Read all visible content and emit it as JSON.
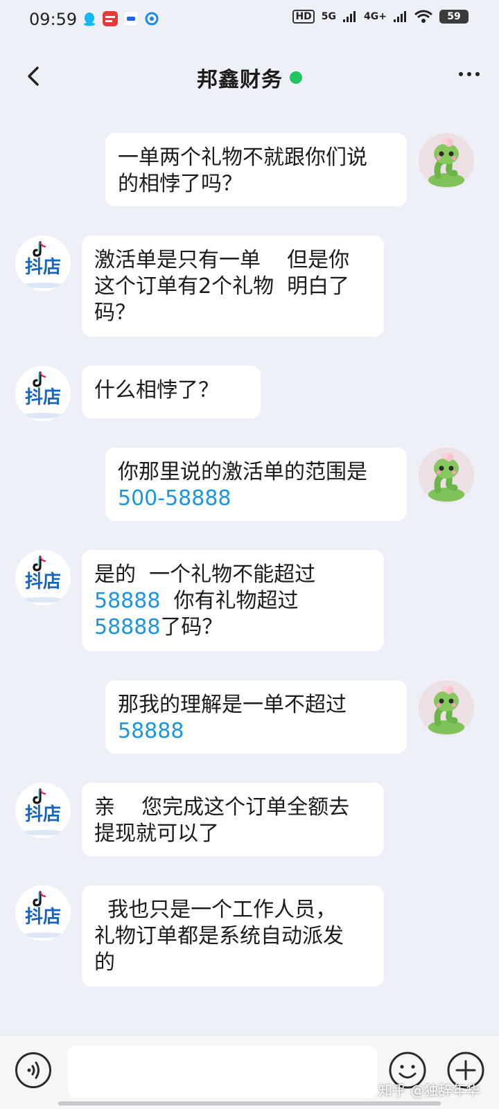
{
  "status_bar": {
    "time": "09:59",
    "network_1": "HD",
    "network_2": "5G",
    "network_3": "4G+",
    "battery": "59"
  },
  "header": {
    "title": "邦鑫财务",
    "online_color": "#22c55e"
  },
  "messages": [
    {
      "sender": "me",
      "avatar": "snake-avatar",
      "parts": [
        {
          "text": "一单两个礼物不就跟你们说\n的相悖了吗？"
        }
      ]
    },
    {
      "sender": "shop",
      "avatar": "douyin-shop-avatar",
      "avatar_label": "抖店",
      "parts": [
        {
          "text": "激活单是只有一单    但是你\n这个订单有2个礼物  明白了\n码？"
        }
      ]
    },
    {
      "sender": "shop",
      "avatar": "douyin-shop-avatar",
      "avatar_label": "抖店",
      "parts": [
        {
          "text": "什么相悖了？"
        }
      ]
    },
    {
      "sender": "me",
      "avatar": "snake-avatar",
      "parts": [
        {
          "text": "你那里说的激活单的范围是\n"
        },
        {
          "text": "500-58888",
          "link": true
        }
      ]
    },
    {
      "sender": "shop",
      "avatar": "douyin-shop-avatar",
      "avatar_label": "抖店",
      "parts": [
        {
          "text": "是的  一个礼物不能超过\n"
        },
        {
          "text": "58888",
          "link": true
        },
        {
          "text": "  你有礼物超过\n"
        },
        {
          "text": "58888",
          "link": true
        },
        {
          "text": "了码？"
        }
      ]
    },
    {
      "sender": "me",
      "avatar": "snake-avatar",
      "parts": [
        {
          "text": "那我的理解是一单不超过\n"
        },
        {
          "text": "58888",
          "link": true
        }
      ]
    },
    {
      "sender": "shop",
      "avatar": "douyin-shop-avatar",
      "avatar_label": "抖店",
      "parts": [
        {
          "text": "亲    您完成这个订单全额去\n提现就可以了"
        }
      ]
    },
    {
      "sender": "shop",
      "avatar": "douyin-shop-avatar",
      "avatar_label": "抖店",
      "parts": [
        {
          "text": "  我也只是一个工作人员，\n礼物订单都是系统自动派发\n的"
        }
      ]
    }
  ],
  "input": {
    "placeholder": ""
  },
  "watermark": "知乎 @独辞年华",
  "colors": {
    "background": "#eef0f7",
    "bubble": "#ffffff",
    "number_highlight": "#1a95e0"
  }
}
